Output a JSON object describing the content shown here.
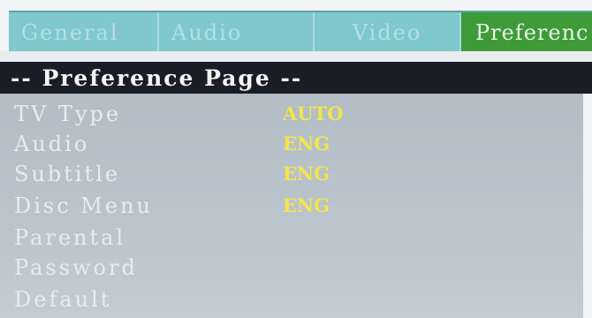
{
  "tabs": [
    {
      "label": "General"
    },
    {
      "label": "Audio"
    },
    {
      "label": "Video"
    },
    {
      "label": "Preferenc",
      "active": true
    }
  ],
  "page": {
    "title": "-- Preference Page --"
  },
  "items": [
    {
      "label": "TV Type",
      "value": "AUTO"
    },
    {
      "label": "Audio",
      "value": "ENG"
    },
    {
      "label": "Subtitle",
      "value": "ENG"
    },
    {
      "label": "Disc Menu",
      "value": "ENG"
    },
    {
      "label": "Parental"
    },
    {
      "label": "Password"
    },
    {
      "label": "Default"
    }
  ],
  "colors": {
    "tab_bar": "#7fc8cc",
    "active_tab": "#3f9a3a",
    "title_bar": "#1a1d27",
    "panel": "#b3bdc6",
    "value_text": "#f3e44a"
  }
}
